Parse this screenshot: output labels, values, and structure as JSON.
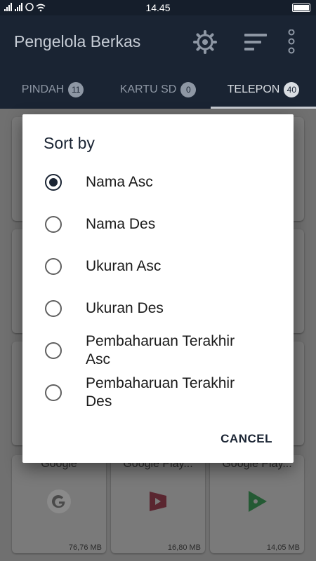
{
  "status_bar": {
    "time": "14.45"
  },
  "app_bar": {
    "title": "Pengelola Berkas"
  },
  "tabs": [
    {
      "label": "PINDAH",
      "count": "11",
      "active": false
    },
    {
      "label": "KARTU SD",
      "count": "0",
      "active": false
    },
    {
      "label": "TELEPON",
      "count": "40",
      "active": true
    }
  ],
  "background_cards": [
    {
      "name": "Google",
      "size": "76,76 MB",
      "icon": "google-icon"
    },
    {
      "name": "Google Play...",
      "size": "16,80 MB",
      "icon": "play-movies-icon"
    },
    {
      "name": "Google Play...",
      "size": "14,05 MB",
      "icon": "play-games-icon"
    }
  ],
  "sort_dialog": {
    "title": "Sort by",
    "options": [
      {
        "label": "Nama Asc",
        "selected": true
      },
      {
        "label": "Nama Des",
        "selected": false
      },
      {
        "label": "Ukuran Asc",
        "selected": false
      },
      {
        "label": "Ukuran Des",
        "selected": false
      },
      {
        "label": "Pembaharuan Terakhir Asc",
        "selected": false
      },
      {
        "label": "Pembaharuan Terakhir Des",
        "selected": false
      }
    ],
    "cancel_label": "CANCEL"
  }
}
